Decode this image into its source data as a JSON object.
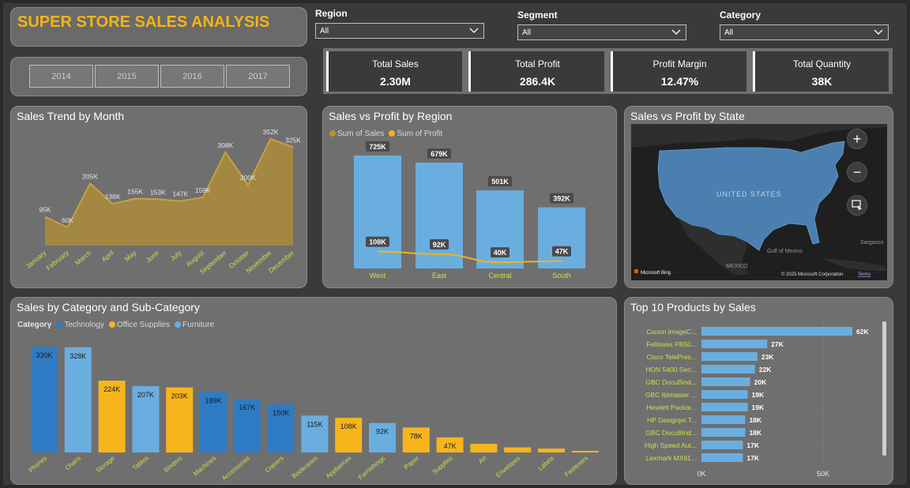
{
  "title": "SUPER STORE SALES ANALYSIS",
  "years": [
    "2014",
    "2015",
    "2016",
    "2017"
  ],
  "filters": [
    {
      "label": "Region",
      "value": "All"
    },
    {
      "label": "Segment",
      "value": "All"
    },
    {
      "label": "Category",
      "value": "All"
    }
  ],
  "kpis": [
    {
      "label": "Total Sales",
      "value": "2.30M"
    },
    {
      "label": "Total Profit",
      "value": "286.4K"
    },
    {
      "label": "Profit Margin",
      "value": "12.47%"
    },
    {
      "label": "Total Quantity",
      "value": "38K"
    }
  ],
  "panels": {
    "trend": "Sales Trend by Month",
    "region": "Sales vs Profit by Region",
    "state": "Sales vs Profit by State",
    "category": "Sales by Category and Sub-Category",
    "top10": "Top 10 Products by Sales"
  },
  "region_legend": {
    "sales": "Sum of Sales",
    "profit": "Sum of Profit"
  },
  "category_legend": {
    "title": "Category",
    "items": [
      "Technology",
      "Office Supplies",
      "Furniture"
    ]
  },
  "map": {
    "country_label": "UNITED STATES",
    "mexico_label": "MEXICO",
    "gulf_label": "Gulf of Mexico",
    "sargasso_label": "Sargasso",
    "bing_label": "Microsoft Bing",
    "copyright": "© 2025 Microsoft Corporation",
    "terms": "Terms"
  },
  "colors": {
    "technology": "#2f7bc4",
    "office_supplies": "#f7b51c",
    "furniture": "#6aaee0",
    "sales_bar": "#6aaee0",
    "profit_line": "#f2b517",
    "area": "#a98a3e",
    "label_text": "#c8e04e"
  },
  "chart_data": [
    {
      "id": "trend",
      "type": "area",
      "categories": [
        "January",
        "February",
        "March",
        "April",
        "May",
        "June",
        "July",
        "August",
        "September",
        "October",
        "November",
        "December"
      ],
      "values": [
        95,
        60,
        205,
        138,
        155,
        153,
        147,
        159,
        308,
        200,
        352,
        325
      ],
      "labels": [
        "95K",
        "60K",
        "205K",
        "138K",
        "155K",
        "153K",
        "147K",
        "159K",
        "308K",
        "200K",
        "352K",
        "325K"
      ]
    },
    {
      "id": "region",
      "type": "bar",
      "categories": [
        "West",
        "East",
        "Central",
        "South"
      ],
      "series": [
        {
          "name": "Sum of Sales",
          "values": [
            725,
            679,
            501,
            392
          ],
          "labels": [
            "725K",
            "679K",
            "501K",
            "392K"
          ]
        },
        {
          "name": "Sum of Profit",
          "values": [
            108,
            92,
            40,
            47
          ],
          "labels": [
            "108K",
            "92K",
            "40K",
            "47K"
          ]
        }
      ]
    },
    {
      "id": "category",
      "type": "bar",
      "categories": [
        "Phones",
        "Chairs",
        "Storage",
        "Tables",
        "Binders",
        "Machines",
        "Accessories",
        "Copiers",
        "Bookcases",
        "Appliances",
        "Furnishings",
        "Paper",
        "Supplies",
        "Art",
        "Envelopes",
        "Labels",
        "Fasteners"
      ],
      "values": [
        330,
        328,
        224,
        207,
        203,
        189,
        167,
        150,
        115,
        108,
        92,
        78,
        47,
        27,
        16,
        12,
        3
      ],
      "labels": [
        "330K",
        "328K",
        "224K",
        "207K",
        "203K",
        "189K",
        "167K",
        "150K",
        "115K",
        "108K",
        "92K",
        "78K",
        "47K",
        "",
        "",
        "",
        ""
      ],
      "groups": [
        "Technology",
        "Furniture",
        "Office Supplies",
        "Furniture",
        "Office Supplies",
        "Technology",
        "Technology",
        "Technology",
        "Furniture",
        "Office Supplies",
        "Furniture",
        "Office Supplies",
        "Office Supplies",
        "Office Supplies",
        "Office Supplies",
        "Office Supplies",
        "Office Supplies"
      ]
    },
    {
      "id": "top10",
      "type": "bar",
      "orientation": "horizontal",
      "categories": [
        "Canon imageC...",
        "Fellowes PB50...",
        "Cisco TelePres...",
        "HON 5400 Seri...",
        "GBC DocuBind...",
        "GBC Ibimaster ...",
        "Hewlett Packar...",
        "HP Designjet T...",
        "GBC DocuBind...",
        "High Speed Aut...",
        "Lexmark MX61..."
      ],
      "values": [
        62,
        27,
        23,
        22,
        20,
        19,
        19,
        18,
        18,
        17,
        17
      ],
      "labels": [
        "62K",
        "27K",
        "23K",
        "22K",
        "20K",
        "19K",
        "19K",
        "18K",
        "18K",
        "17K",
        "17K"
      ],
      "x_ticks": [
        "0K",
        "50K"
      ],
      "xlim": [
        0,
        62
      ]
    }
  ]
}
